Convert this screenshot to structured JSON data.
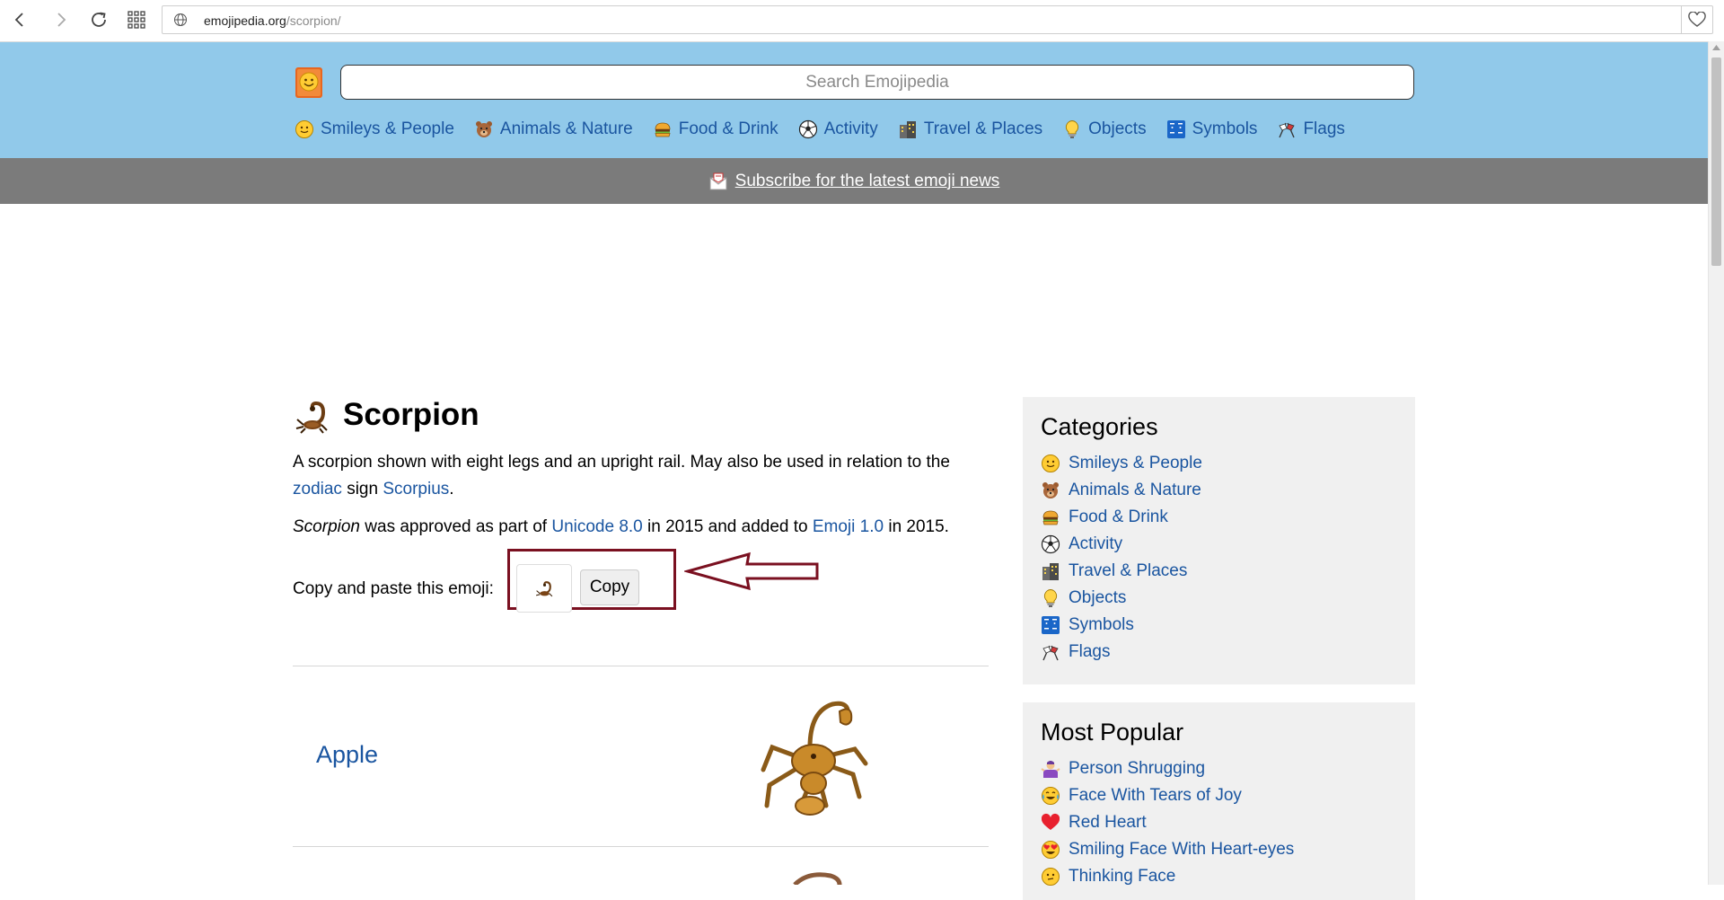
{
  "browser": {
    "url_host": "emojipedia.org",
    "url_path": "/scorpion/"
  },
  "header": {
    "search_placeholder": "Search Emojipedia",
    "nav": [
      {
        "label": "Smileys & People",
        "icon": "smiley-icon"
      },
      {
        "label": "Animals & Nature",
        "icon": "bear-icon"
      },
      {
        "label": "Food & Drink",
        "icon": "burger-icon"
      },
      {
        "label": "Activity",
        "icon": "soccer-ball-icon"
      },
      {
        "label": "Travel & Places",
        "icon": "buildings-icon"
      },
      {
        "label": "Objects",
        "icon": "light-bulb-icon"
      },
      {
        "label": "Symbols",
        "icon": "symbols-icon"
      },
      {
        "label": "Flags",
        "icon": "flags-icon"
      }
    ]
  },
  "subscribe": {
    "text": "Subscribe for the latest emoji news"
  },
  "emoji": {
    "title": "Scorpion",
    "desc_part1": "A scorpion shown with eight legs and an upright rail. May also be used in relation to the ",
    "desc_link1": "zodiac",
    "desc_part2": " sign ",
    "desc_link2": "Scorpius",
    "desc_part3": ".",
    "approved_name": "Scorpion",
    "approved_part1": " was approved as part of ",
    "approved_link1": "Unicode 8.0",
    "approved_part2": " in 2015 and added to ",
    "approved_link2": "Emoji 1.0",
    "approved_part3": " in 2015.",
    "copy_label": "Copy and paste this emoji:",
    "copy_button": "Copy"
  },
  "vendors": [
    {
      "name": "Apple"
    }
  ],
  "sidebar": {
    "categories_title": "Categories",
    "categories": [
      {
        "label": "Smileys & People",
        "icon": "smiley-icon"
      },
      {
        "label": "Animals & Nature",
        "icon": "bear-icon"
      },
      {
        "label": "Food & Drink",
        "icon": "burger-icon"
      },
      {
        "label": "Activity",
        "icon": "soccer-ball-icon"
      },
      {
        "label": "Travel & Places",
        "icon": "buildings-icon"
      },
      {
        "label": "Objects",
        "icon": "light-bulb-icon"
      },
      {
        "label": "Symbols",
        "icon": "symbols-icon"
      },
      {
        "label": "Flags",
        "icon": "flags-icon"
      }
    ],
    "popular_title": "Most Popular",
    "popular": [
      {
        "label": "Person Shrugging",
        "icon": "person-shrugging-icon"
      },
      {
        "label": "Face With Tears of Joy",
        "icon": "tears-of-joy-icon"
      },
      {
        "label": "Red Heart",
        "icon": "red-heart-icon"
      },
      {
        "label": "Smiling Face With Heart-eyes",
        "icon": "heart-eyes-icon"
      },
      {
        "label": "Thinking Face",
        "icon": "thinking-face-icon"
      }
    ]
  },
  "colors": {
    "header_bg": "#91c9ea",
    "subscribe_bg": "#7b7b7b",
    "link": "#1a55a0",
    "highlight": "#7a1020"
  }
}
